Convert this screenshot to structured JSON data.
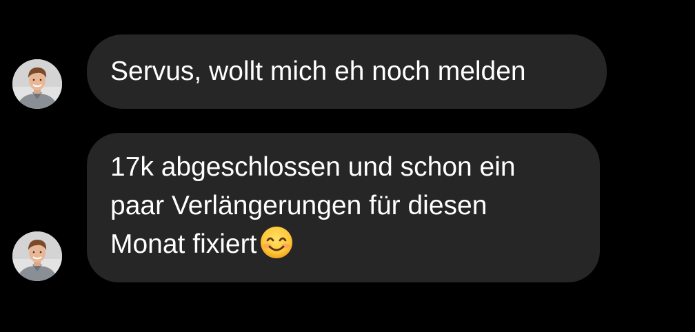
{
  "messages": [
    {
      "sender_avatar": "avatar-photo",
      "text": "Servus, wollt mich eh noch melden"
    },
    {
      "sender_avatar": "avatar-photo",
      "lines": [
        "17k abgeschlossen und schon ein",
        "paar Verlängerungen für diesen",
        "Monat fixiert"
      ],
      "emoji": "smiling-face-with-smiling-eyes-icon"
    }
  ],
  "colors": {
    "background": "#000000",
    "bubble": "#262626",
    "text": "#ffffff"
  }
}
